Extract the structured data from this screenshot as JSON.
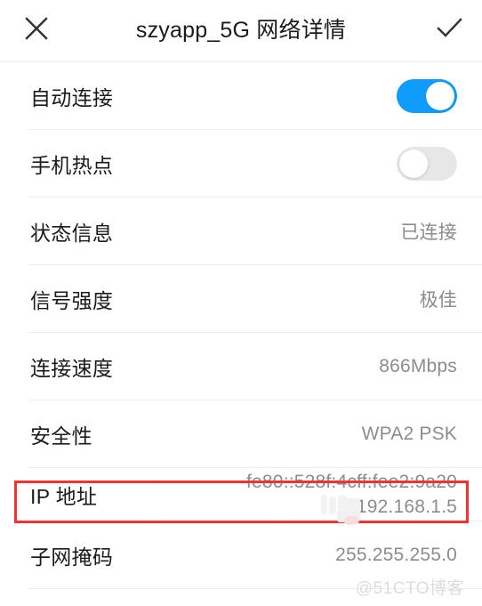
{
  "header": {
    "title": "szyapp_5G  网络详情",
    "close_icon": "close-x-icon",
    "confirm_icon": "check-icon"
  },
  "rows": [
    {
      "label": "自动连接",
      "type": "toggle",
      "toggle_state": "on"
    },
    {
      "label": "手机热点",
      "type": "toggle",
      "toggle_state": "off"
    },
    {
      "label": "状态信息",
      "type": "value",
      "value": "已连接"
    },
    {
      "label": "信号强度",
      "type": "value",
      "value": "极佳"
    },
    {
      "label": "连接速度",
      "type": "value",
      "value": "866Mbps"
    },
    {
      "label": "安全性",
      "type": "value",
      "value": "WPA2 PSK"
    },
    {
      "label": "IP 地址",
      "type": "ip",
      "value_ipv6": "fe80::528f:4cff:fee2:9a20",
      "value_ipv4": "192.168.1.5"
    },
    {
      "label": "子网掩码",
      "type": "value",
      "value": "255.255.255.0"
    }
  ],
  "watermark": "@51CTO博客",
  "colors": {
    "toggle_on": "#109cfd",
    "toggle_off": "#e7e7e7",
    "highlight_border": "#f43030",
    "label_text": "#1b1b1b",
    "value_text": "#8c8c8c",
    "divider": "#ededed"
  }
}
